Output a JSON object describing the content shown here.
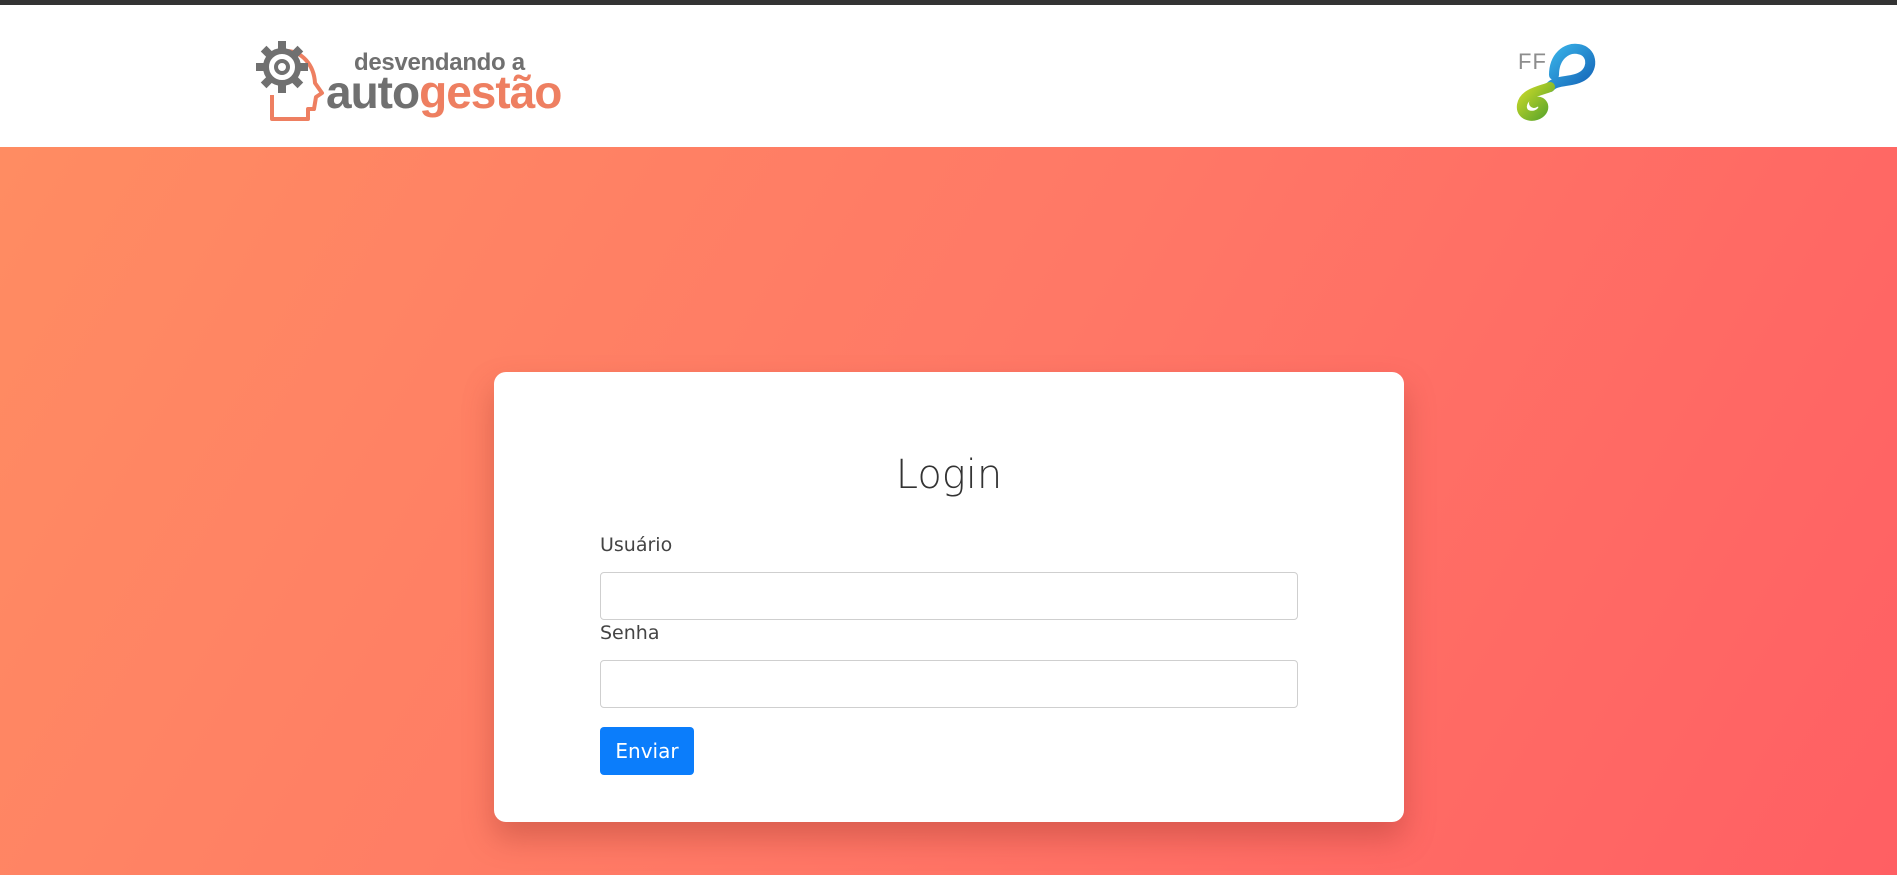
{
  "header": {
    "brand": {
      "tagline": "desvendando a",
      "name_part1": "auto",
      "name_part2": "gestão",
      "icon": "gear-head-icon",
      "colors": {
        "gray": "#707070",
        "orange": "#ee7f61"
      }
    },
    "partner": {
      "text": "FF",
      "icon": "infinity-knot-icon",
      "colors": {
        "blue": "#1a8fd0",
        "green": "#8cbf2a"
      }
    }
  },
  "hero": {
    "gradient_colors": [
      "#ff8c62",
      "#ff7866",
      "#ff5f63"
    ]
  },
  "login": {
    "title": "Login",
    "user_label": "Usuário",
    "user_value": "",
    "password_label": "Senha",
    "password_value": "",
    "submit_label": "Enviar",
    "submit_color": "#0b7dfb"
  }
}
